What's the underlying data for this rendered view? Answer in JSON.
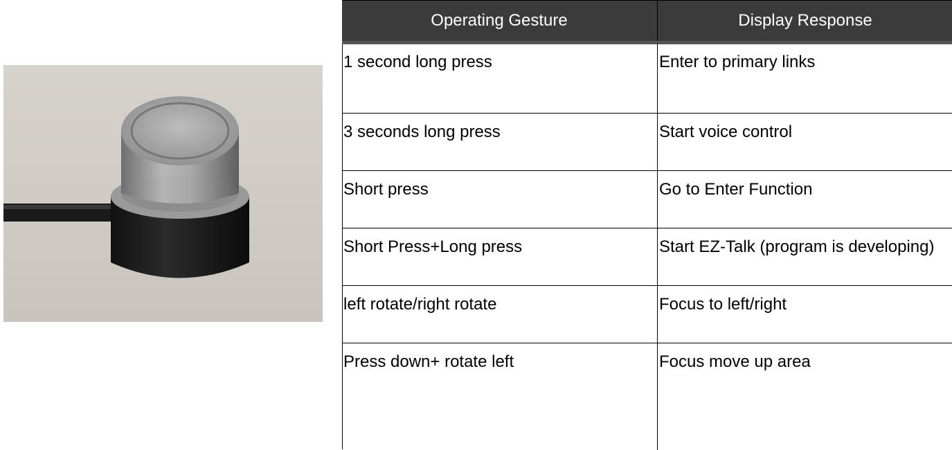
{
  "table": {
    "headers": [
      "Operating Gesture",
      "Display Response"
    ],
    "rows": [
      {
        "gesture": "1 second long press",
        "response": "Enter to primary links"
      },
      {
        "gesture": "3 seconds long press",
        "response": "Start voice control"
      },
      {
        "gesture": "Short press",
        "response": "Go to Enter Function"
      },
      {
        "gesture": "Short Press+Long press",
        "response": "Start EZ-Talk (program is developing)"
      },
      {
        "gesture": "left rotate/right rotate",
        "response": "Focus to left/right"
      },
      {
        "gesture": "Press down+ rotate left",
        "response": "Focus move up area"
      }
    ]
  },
  "colors": {
    "header_bg": "#3b3b3b",
    "header_text": "#ffffff",
    "photo_bg": "#d2cdc6"
  }
}
